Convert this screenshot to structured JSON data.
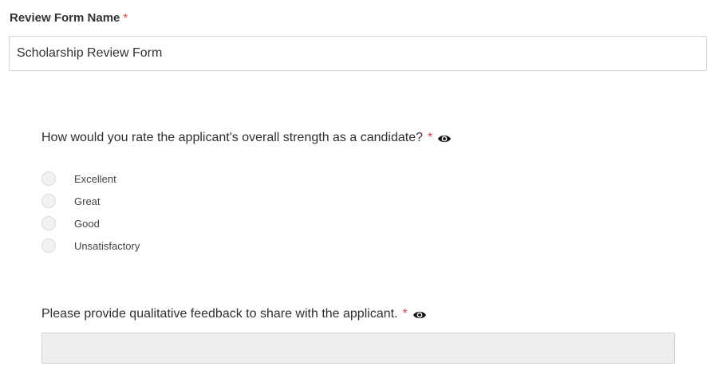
{
  "form_name": {
    "label": "Review Form Name",
    "required_mark": "*",
    "value": "Scholarship Review Form"
  },
  "question1": {
    "text": "How would you rate the applicant's overall strength as a candidate?",
    "required_mark": "*",
    "icon": "eye-icon",
    "options": [
      "Excellent",
      "Great",
      "Good",
      "Unsatisfactory"
    ]
  },
  "question2": {
    "text": "Please provide qualitative feedback to share with the applicant.",
    "required_mark": "*",
    "icon": "eye-icon",
    "answer": ""
  },
  "colors": {
    "required": "#e0453a",
    "disabled_field": "#efeeef"
  }
}
